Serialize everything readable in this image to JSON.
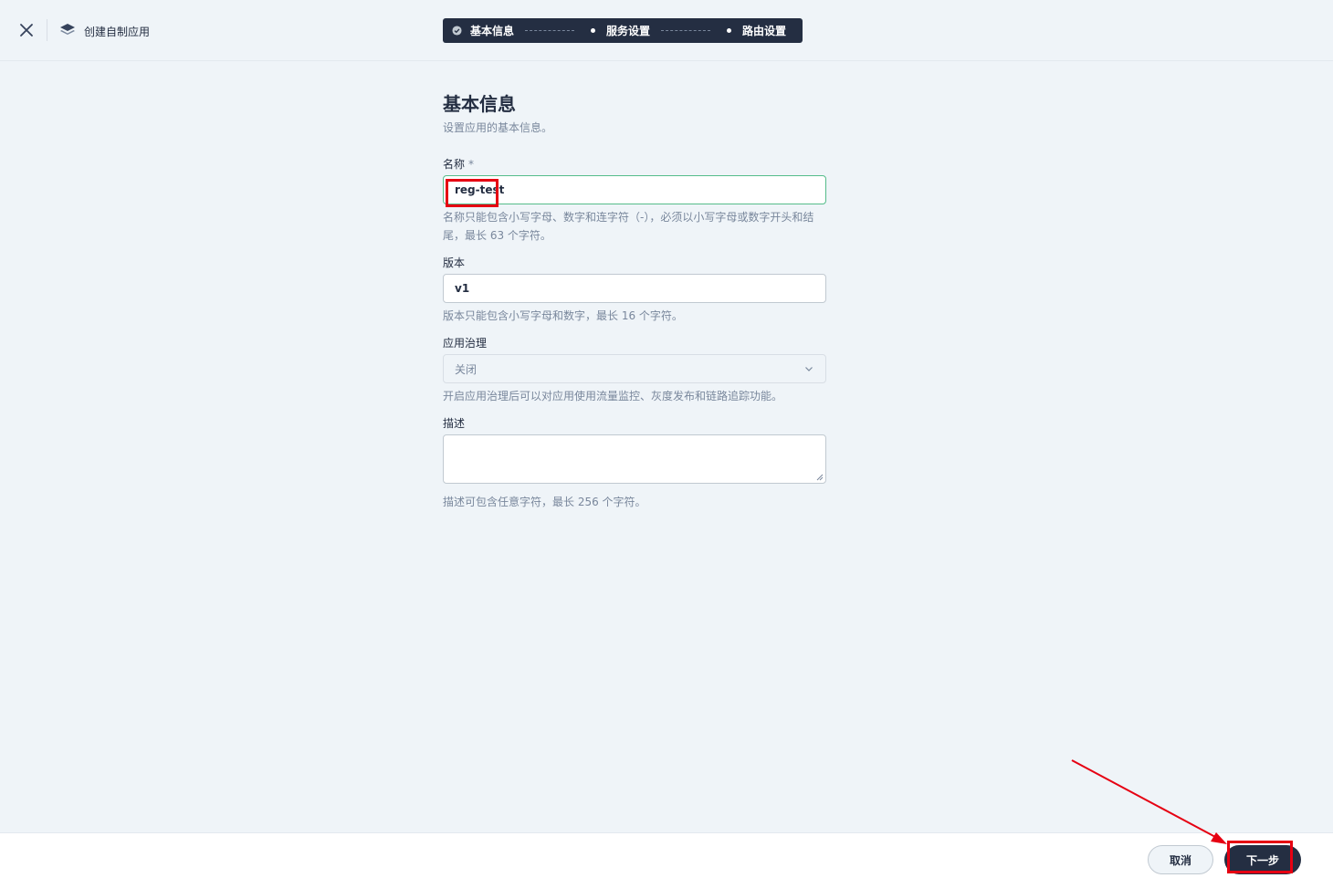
{
  "header": {
    "app_title": "创建自制应用"
  },
  "steps": [
    {
      "label": "基本信息",
      "status": "done"
    },
    {
      "label": "服务设置",
      "status": "pending"
    },
    {
      "label": "路由设置",
      "status": "pending"
    }
  ],
  "form": {
    "title": "基本信息",
    "description": "设置应用的基本信息。",
    "name": {
      "label": "名称",
      "required_mark": "*",
      "value": "reg-test",
      "hint": "名称只能包含小写字母、数字和连字符（-），必须以小写字母或数字开头和结尾，最长 63 个字符。"
    },
    "version": {
      "label": "版本",
      "value": "v1",
      "hint": "版本只能包含小写字母和数字，最长 16 个字符。"
    },
    "governance": {
      "label": "应用治理",
      "value": "关闭",
      "hint": "开启应用治理后可以对应用使用流量监控、灰度发布和链路追踪功能。"
    },
    "description_field": {
      "label": "描述",
      "value": "",
      "hint": "描述可包含任意字符，最长 256 个字符。"
    }
  },
  "footer": {
    "cancel_label": "取消",
    "next_label": "下一步"
  },
  "annotation": {
    "color": "#e60012"
  }
}
